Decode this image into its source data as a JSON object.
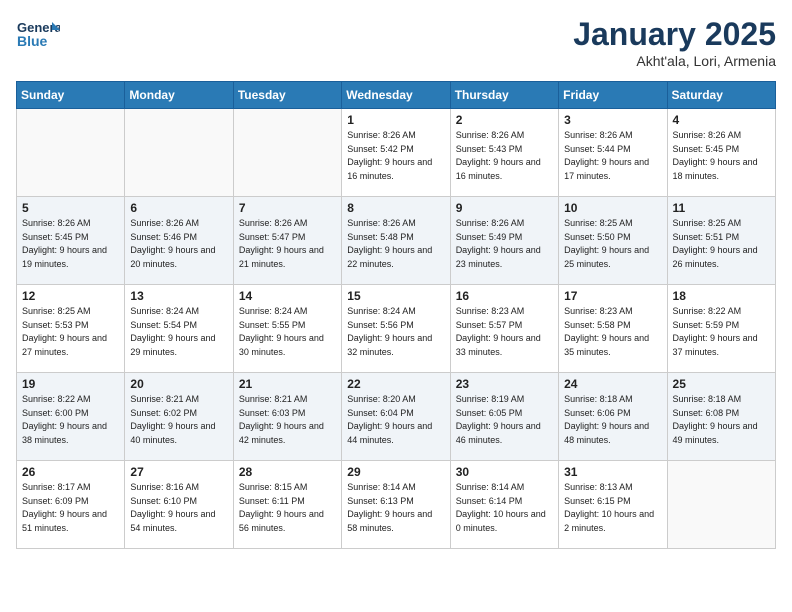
{
  "logo": {
    "line1": "General",
    "line2": "Blue"
  },
  "title": "January 2025",
  "subtitle": "Akht'ala, Lori, Armenia",
  "days_header": [
    "Sunday",
    "Monday",
    "Tuesday",
    "Wednesday",
    "Thursday",
    "Friday",
    "Saturday"
  ],
  "weeks": [
    [
      {
        "num": "",
        "sunrise": "",
        "sunset": "",
        "daylight": ""
      },
      {
        "num": "",
        "sunrise": "",
        "sunset": "",
        "daylight": ""
      },
      {
        "num": "",
        "sunrise": "",
        "sunset": "",
        "daylight": ""
      },
      {
        "num": "1",
        "sunrise": "Sunrise: 8:26 AM",
        "sunset": "Sunset: 5:42 PM",
        "daylight": "Daylight: 9 hours and 16 minutes."
      },
      {
        "num": "2",
        "sunrise": "Sunrise: 8:26 AM",
        "sunset": "Sunset: 5:43 PM",
        "daylight": "Daylight: 9 hours and 16 minutes."
      },
      {
        "num": "3",
        "sunrise": "Sunrise: 8:26 AM",
        "sunset": "Sunset: 5:44 PM",
        "daylight": "Daylight: 9 hours and 17 minutes."
      },
      {
        "num": "4",
        "sunrise": "Sunrise: 8:26 AM",
        "sunset": "Sunset: 5:45 PM",
        "daylight": "Daylight: 9 hours and 18 minutes."
      }
    ],
    [
      {
        "num": "5",
        "sunrise": "Sunrise: 8:26 AM",
        "sunset": "Sunset: 5:45 PM",
        "daylight": "Daylight: 9 hours and 19 minutes."
      },
      {
        "num": "6",
        "sunrise": "Sunrise: 8:26 AM",
        "sunset": "Sunset: 5:46 PM",
        "daylight": "Daylight: 9 hours and 20 minutes."
      },
      {
        "num": "7",
        "sunrise": "Sunrise: 8:26 AM",
        "sunset": "Sunset: 5:47 PM",
        "daylight": "Daylight: 9 hours and 21 minutes."
      },
      {
        "num": "8",
        "sunrise": "Sunrise: 8:26 AM",
        "sunset": "Sunset: 5:48 PM",
        "daylight": "Daylight: 9 hours and 22 minutes."
      },
      {
        "num": "9",
        "sunrise": "Sunrise: 8:26 AM",
        "sunset": "Sunset: 5:49 PM",
        "daylight": "Daylight: 9 hours and 23 minutes."
      },
      {
        "num": "10",
        "sunrise": "Sunrise: 8:25 AM",
        "sunset": "Sunset: 5:50 PM",
        "daylight": "Daylight: 9 hours and 25 minutes."
      },
      {
        "num": "11",
        "sunrise": "Sunrise: 8:25 AM",
        "sunset": "Sunset: 5:51 PM",
        "daylight": "Daylight: 9 hours and 26 minutes."
      }
    ],
    [
      {
        "num": "12",
        "sunrise": "Sunrise: 8:25 AM",
        "sunset": "Sunset: 5:53 PM",
        "daylight": "Daylight: 9 hours and 27 minutes."
      },
      {
        "num": "13",
        "sunrise": "Sunrise: 8:24 AM",
        "sunset": "Sunset: 5:54 PM",
        "daylight": "Daylight: 9 hours and 29 minutes."
      },
      {
        "num": "14",
        "sunrise": "Sunrise: 8:24 AM",
        "sunset": "Sunset: 5:55 PM",
        "daylight": "Daylight: 9 hours and 30 minutes."
      },
      {
        "num": "15",
        "sunrise": "Sunrise: 8:24 AM",
        "sunset": "Sunset: 5:56 PM",
        "daylight": "Daylight: 9 hours and 32 minutes."
      },
      {
        "num": "16",
        "sunrise": "Sunrise: 8:23 AM",
        "sunset": "Sunset: 5:57 PM",
        "daylight": "Daylight: 9 hours and 33 minutes."
      },
      {
        "num": "17",
        "sunrise": "Sunrise: 8:23 AM",
        "sunset": "Sunset: 5:58 PM",
        "daylight": "Daylight: 9 hours and 35 minutes."
      },
      {
        "num": "18",
        "sunrise": "Sunrise: 8:22 AM",
        "sunset": "Sunset: 5:59 PM",
        "daylight": "Daylight: 9 hours and 37 minutes."
      }
    ],
    [
      {
        "num": "19",
        "sunrise": "Sunrise: 8:22 AM",
        "sunset": "Sunset: 6:00 PM",
        "daylight": "Daylight: 9 hours and 38 minutes."
      },
      {
        "num": "20",
        "sunrise": "Sunrise: 8:21 AM",
        "sunset": "Sunset: 6:02 PM",
        "daylight": "Daylight: 9 hours and 40 minutes."
      },
      {
        "num": "21",
        "sunrise": "Sunrise: 8:21 AM",
        "sunset": "Sunset: 6:03 PM",
        "daylight": "Daylight: 9 hours and 42 minutes."
      },
      {
        "num": "22",
        "sunrise": "Sunrise: 8:20 AM",
        "sunset": "Sunset: 6:04 PM",
        "daylight": "Daylight: 9 hours and 44 minutes."
      },
      {
        "num": "23",
        "sunrise": "Sunrise: 8:19 AM",
        "sunset": "Sunset: 6:05 PM",
        "daylight": "Daylight: 9 hours and 46 minutes."
      },
      {
        "num": "24",
        "sunrise": "Sunrise: 8:18 AM",
        "sunset": "Sunset: 6:06 PM",
        "daylight": "Daylight: 9 hours and 48 minutes."
      },
      {
        "num": "25",
        "sunrise": "Sunrise: 8:18 AM",
        "sunset": "Sunset: 6:08 PM",
        "daylight": "Daylight: 9 hours and 49 minutes."
      }
    ],
    [
      {
        "num": "26",
        "sunrise": "Sunrise: 8:17 AM",
        "sunset": "Sunset: 6:09 PM",
        "daylight": "Daylight: 9 hours and 51 minutes."
      },
      {
        "num": "27",
        "sunrise": "Sunrise: 8:16 AM",
        "sunset": "Sunset: 6:10 PM",
        "daylight": "Daylight: 9 hours and 54 minutes."
      },
      {
        "num": "28",
        "sunrise": "Sunrise: 8:15 AM",
        "sunset": "Sunset: 6:11 PM",
        "daylight": "Daylight: 9 hours and 56 minutes."
      },
      {
        "num": "29",
        "sunrise": "Sunrise: 8:14 AM",
        "sunset": "Sunset: 6:13 PM",
        "daylight": "Daylight: 9 hours and 58 minutes."
      },
      {
        "num": "30",
        "sunrise": "Sunrise: 8:14 AM",
        "sunset": "Sunset: 6:14 PM",
        "daylight": "Daylight: 10 hours and 0 minutes."
      },
      {
        "num": "31",
        "sunrise": "Sunrise: 8:13 AM",
        "sunset": "Sunset: 6:15 PM",
        "daylight": "Daylight: 10 hours and 2 minutes."
      },
      {
        "num": "",
        "sunrise": "",
        "sunset": "",
        "daylight": ""
      }
    ]
  ]
}
